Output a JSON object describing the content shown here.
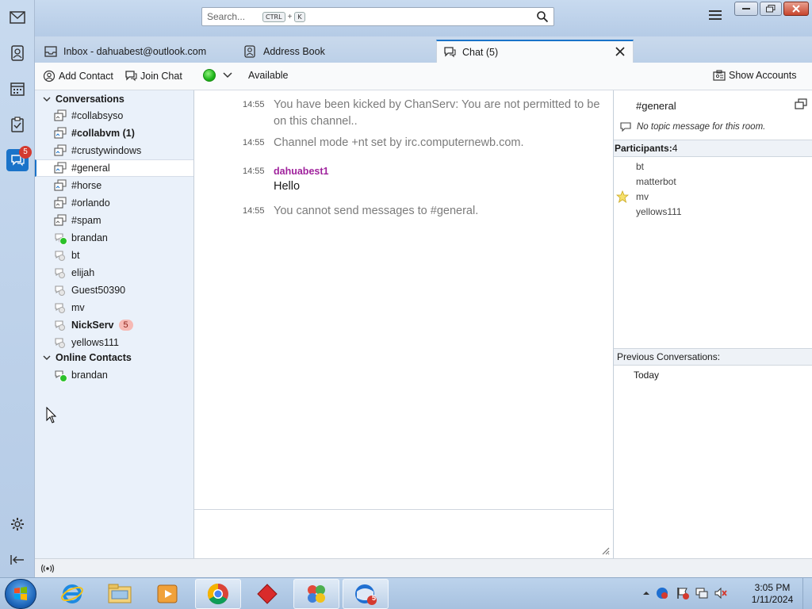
{
  "search": {
    "placeholder": "Search...",
    "shortcut_ctrl": "CTRL",
    "shortcut_plus": "+",
    "shortcut_key": "K"
  },
  "spaces": {
    "chat_badge": "5"
  },
  "tabs": [
    {
      "label": "Inbox - dahuabest@outlook.com"
    },
    {
      "label": "Address Book"
    },
    {
      "label": "Chat (5)"
    }
  ],
  "toolbar": {
    "add_contact": "Add Contact",
    "join_chat": "Join Chat",
    "status": "Available",
    "show_accounts": "Show Accounts"
  },
  "sidebar": {
    "conversations_header": "Conversations",
    "conversations": [
      {
        "name": "#collabsyso",
        "bold": false
      },
      {
        "name": "#collabvm (1)",
        "bold": true
      },
      {
        "name": "#crustywindows",
        "bold": false
      },
      {
        "name": "#general",
        "bold": false,
        "selected": true
      },
      {
        "name": "#horse",
        "bold": false
      },
      {
        "name": "#orlando",
        "bold": false
      },
      {
        "name": "#spam",
        "bold": false
      },
      {
        "name": "brandan",
        "bold": false
      },
      {
        "name": "bt",
        "bold": false
      },
      {
        "name": "elijah",
        "bold": false
      },
      {
        "name": "Guest50390",
        "bold": false
      },
      {
        "name": "mv",
        "bold": false
      },
      {
        "name": "NickServ",
        "bold": true,
        "badge": "5"
      },
      {
        "name": "yellows111",
        "bold": false
      }
    ],
    "online_header": "Online Contacts",
    "online": [
      {
        "name": "brandan"
      }
    ]
  },
  "chat": {
    "messages": [
      {
        "time": "14:55",
        "text": "You have been kicked by ChanServ: You are not permitted to be on this channel.."
      },
      {
        "time": "14:55",
        "text": "Channel mode +nt set by irc.computernewb.com."
      },
      {
        "time": "14:55",
        "sender": "dahuabest1",
        "text": "Hello"
      },
      {
        "time": "14:55",
        "text": "You cannot send messages to #general."
      }
    ]
  },
  "room": {
    "name": "#general",
    "topic": "No topic message for this room.",
    "participants_label": "Participants:",
    "participants_count": "4",
    "participants": [
      "bt",
      "matterbot",
      "mv",
      "yellows111"
    ],
    "previous_label": "Previous Conversations:",
    "previous": [
      "Today"
    ]
  },
  "taskbar": {
    "time": "3:05 PM",
    "date": "1/11/2024",
    "thunderbird_badge": "5"
  },
  "colors": {
    "accent": "#1a73c9",
    "sender": "#a0239d",
    "online": "#2bc12a"
  }
}
